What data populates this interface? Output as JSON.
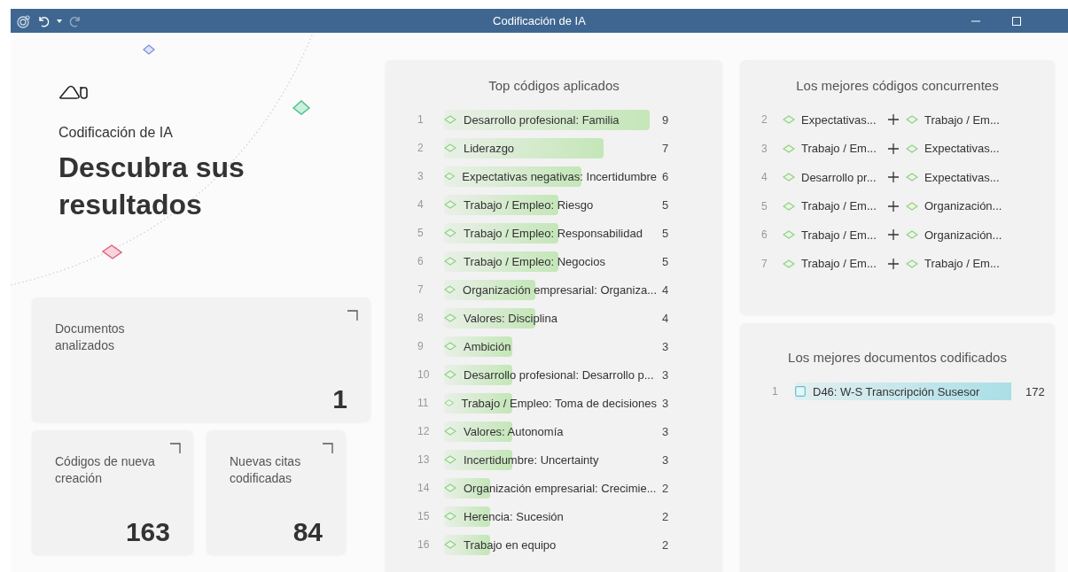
{
  "title_bar": {
    "title": "Codificación de IA",
    "redo_disabled": true
  },
  "hero": {
    "app_name": "Codificación de IA",
    "headline": "Descubra sus resultados"
  },
  "stats": [
    {
      "label": "Documentos analizados",
      "value": "1"
    },
    {
      "label": "Códigos de nueva creación",
      "value": "163"
    },
    {
      "label": "Nuevas citas codificadas",
      "value": "84"
    }
  ],
  "top_codes": {
    "title": "Top códigos aplicados",
    "rows": [
      {
        "rank": "1",
        "name": "Desarrollo profesional: Familia",
        "count": "9"
      },
      {
        "rank": "2",
        "name": "Liderazgo",
        "count": "7"
      },
      {
        "rank": "3",
        "name": "Expectativas negativas: Incertidumbre",
        "count": "6"
      },
      {
        "rank": "4",
        "name": "Trabajo / Empleo: Riesgo",
        "count": "5"
      },
      {
        "rank": "5",
        "name": "Trabajo / Empleo: Responsabilidad",
        "count": "5"
      },
      {
        "rank": "6",
        "name": "Trabajo / Empleo: Negocios",
        "count": "5"
      },
      {
        "rank": "7",
        "name": "Organización empresarial: Organiza...",
        "count": "4"
      },
      {
        "rank": "8",
        "name": "Valores: Disciplina",
        "count": "4"
      },
      {
        "rank": "9",
        "name": "Ambición",
        "count": "3"
      },
      {
        "rank": "10",
        "name": "Desarrollo profesional: Desarrollo p...",
        "count": "3"
      },
      {
        "rank": "11",
        "name": "Trabajo / Empleo: Toma de decisiones",
        "count": "3"
      },
      {
        "rank": "12",
        "name": "Valores: Autonomía",
        "count": "3"
      },
      {
        "rank": "13",
        "name": "Incertidumbre: Uncertainty",
        "count": "3"
      },
      {
        "rank": "14",
        "name": "Organización empresarial: Crecimie...",
        "count": "2"
      },
      {
        "rank": "15",
        "name": "Herencia: Sucesión",
        "count": "2"
      },
      {
        "rank": "16",
        "name": "Trabajo en equipo",
        "count": "2"
      }
    ]
  },
  "co_occurring": {
    "title": "Los mejores códigos concurrentes",
    "rows": [
      {
        "rank": "2",
        "first": "Expectativas...",
        "second": "Trabajo / Em..."
      },
      {
        "rank": "3",
        "first": "Trabajo / Em...",
        "second": "Expectativas..."
      },
      {
        "rank": "4",
        "first": "Desarrollo pr...",
        "second": "Expectativas..."
      },
      {
        "rank": "5",
        "first": "Trabajo / Em...",
        "second": "Organización..."
      },
      {
        "rank": "6",
        "first": "Trabajo / Em...",
        "second": "Organización..."
      },
      {
        "rank": "7",
        "first": "Trabajo / Em...",
        "second": "Trabajo / Em..."
      }
    ]
  },
  "top_documents": {
    "title": "Los mejores documentos codificados",
    "rows": [
      {
        "rank": "1",
        "name": "D46: W-S Transcripción Susesor",
        "count": "172"
      }
    ]
  }
}
